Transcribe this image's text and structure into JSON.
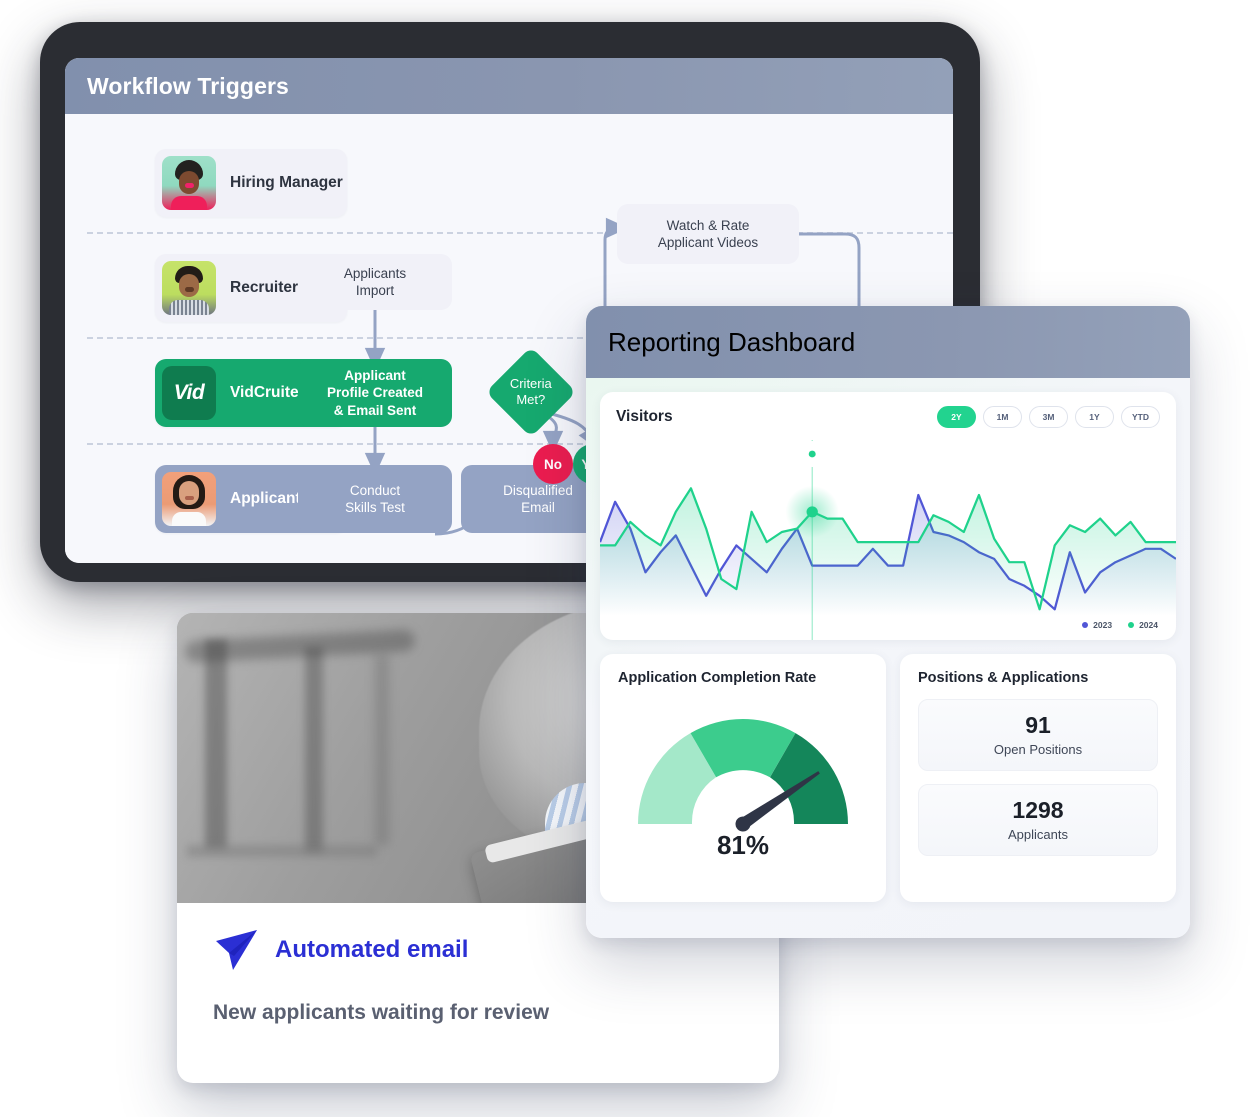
{
  "workflow": {
    "title": "Workflow Triggers",
    "lanes": [
      {
        "label": "Hiring Manager",
        "avatar": "avatar-hiring-manager"
      },
      {
        "label": "Recruiter",
        "avatar": "avatar-recruiter"
      },
      {
        "label": "VidCruiter",
        "avatar": "vidcruiter-logo"
      },
      {
        "label": "Applicant",
        "avatar": "avatar-applicant"
      }
    ],
    "logo_text": "Vid",
    "nodes": {
      "applicants_import": "Applicants\nImport",
      "profile_created": "Applicant\nProfile Created\n& Email Sent",
      "conduct_skills_test": "Conduct\nSkills Test",
      "disqualified_email": "Disqualified\nEmail",
      "criteria": "Criteria\nMet?",
      "watch_rate_1": "Watch & Rate\nApplicant Videos",
      "watch_rate_2": "Watch & Rate\nApplicant Videos",
      "no_label": "No",
      "yes_label": "Yes"
    },
    "colors": {
      "green": "#16a96f",
      "slate": "#94a3c4",
      "red": "#ec1c4f",
      "header": "#8a96b0"
    }
  },
  "dashboard": {
    "title": "Reporting Dashboard",
    "visitors": {
      "title": "Visitors",
      "ranges": [
        {
          "label": "2Y",
          "active": true
        },
        {
          "label": "1M",
          "active": false
        },
        {
          "label": "3M",
          "active": false
        },
        {
          "label": "1Y",
          "active": false
        },
        {
          "label": "YTD",
          "active": false
        }
      ],
      "legend": [
        {
          "label": "2023",
          "color": "#5156d6"
        },
        {
          "label": "2024",
          "color": "#1fd28c"
        }
      ]
    },
    "completion": {
      "title": "Application Completion Rate",
      "value_label": "81%"
    },
    "positions": {
      "title": "Positions & Applications",
      "stats": [
        {
          "value": "91",
          "label": "Open Positions"
        },
        {
          "value": "1298",
          "label": "Applicants"
        }
      ]
    }
  },
  "email": {
    "title": "Automated email",
    "subtitle": "New applicants waiting for review",
    "icon": "paper-plane-icon",
    "accent": "#2b2fd4"
  },
  "chart_data": {
    "type": "line",
    "title": "Visitors",
    "xlabel": "",
    "ylabel": "",
    "grid": false,
    "legend_position": "bottom-right",
    "ylim": [
      0,
      100
    ],
    "x": [
      0,
      1,
      2,
      3,
      4,
      5,
      6,
      7,
      8,
      9,
      10,
      11,
      12,
      13,
      14,
      15,
      16,
      17,
      18,
      19,
      20,
      21,
      22,
      23,
      24,
      25,
      26,
      27,
      28,
      29,
      30,
      31,
      32,
      33,
      34,
      35,
      36,
      37,
      38
    ],
    "series": [
      {
        "name": "2023",
        "color": "#5156d6",
        "values": [
          44,
          68,
          52,
          26,
          38,
          48,
          30,
          12,
          28,
          42,
          34,
          26,
          40,
          52,
          30,
          30,
          30,
          30,
          40,
          30,
          30,
          72,
          50,
          48,
          44,
          38,
          34,
          22,
          18,
          12,
          4,
          38,
          14,
          26,
          32,
          36,
          40,
          40,
          34
        ]
      },
      {
        "name": "2024",
        "color": "#1fd28c",
        "values": [
          42,
          42,
          56,
          48,
          42,
          62,
          76,
          52,
          22,
          16,
          62,
          44,
          50,
          52,
          62,
          58,
          58,
          44,
          44,
          44,
          44,
          44,
          60,
          56,
          50,
          72,
          46,
          32,
          32,
          4,
          42,
          54,
          50,
          58,
          48,
          56,
          44,
          44,
          44
        ]
      }
    ],
    "highlight": {
      "series": "2024",
      "index": 14,
      "value": 62
    }
  }
}
